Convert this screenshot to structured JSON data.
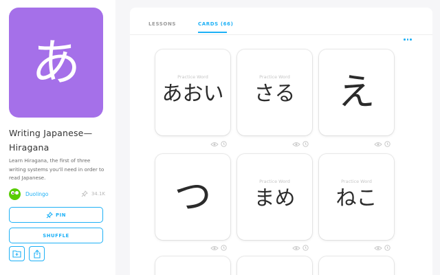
{
  "deck": {
    "icon_char": "あ",
    "title_line1": "Writing Japanese—",
    "title_line2": "Hiragana",
    "description": "Learn Hiragana, the first of three writing systems you'll need in order to read Japanese.",
    "author": "Duolingo",
    "pin_count": "34.1K",
    "accent_color": "#a570e9",
    "brand_color": "#1cb0f6"
  },
  "buttons": {
    "pin": "PIN",
    "shuffle": "SHUFFLE"
  },
  "tabs": {
    "lessons": "LESSONS",
    "cards": "CARDS (66)",
    "active": "cards"
  },
  "cards": [
    {
      "label": "Practice Word",
      "text": "あおい"
    },
    {
      "label": "Practice Word",
      "text": "さる"
    },
    {
      "label": "",
      "text": "え"
    },
    {
      "label": "",
      "text": "つ"
    },
    {
      "label": "Practice Word",
      "text": "まめ"
    },
    {
      "label": "Practice Word",
      "text": "ねこ"
    }
  ]
}
